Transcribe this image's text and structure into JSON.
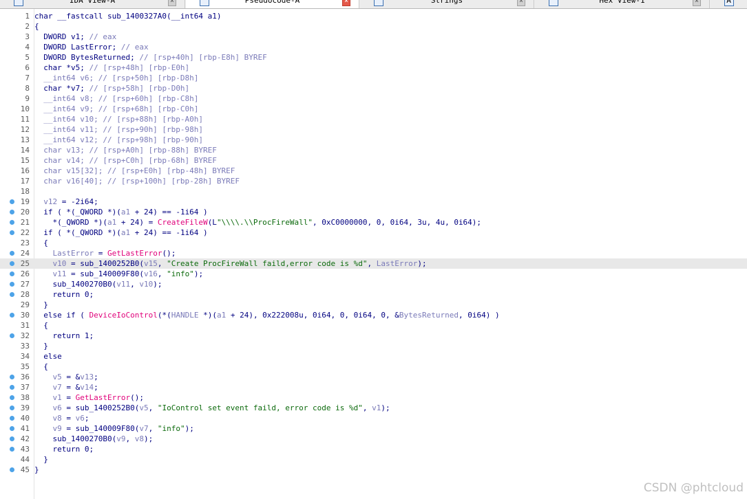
{
  "tabs": [
    {
      "label": "IDA View-A",
      "icon": "ida-view-icon",
      "active": false,
      "close_red": false
    },
    {
      "label": "Pseudocode-A",
      "icon": "pseudocode-icon",
      "active": true,
      "close_red": true
    },
    {
      "label": "Strings",
      "icon": "strings-icon",
      "active": false,
      "close_red": false
    },
    {
      "label": "Hex View-1",
      "icon": "hex-view-icon",
      "active": false,
      "close_red": false
    },
    {
      "label": "A",
      "icon": "structures-icon",
      "active": false,
      "close_red": false
    }
  ],
  "highlighted_line": 25,
  "lines": [
    {
      "n": "1",
      "dot": false,
      "tokens": [
        [
          "def",
          "char __fastcall sub_1400327A0(__int64 a1)"
        ]
      ]
    },
    {
      "n": "2",
      "dot": false,
      "tokens": [
        [
          "def",
          "{"
        ]
      ]
    },
    {
      "n": "3",
      "dot": false,
      "tokens": [
        [
          "def",
          "  DWORD v1; "
        ],
        [
          "cmt",
          "// eax"
        ]
      ]
    },
    {
      "n": "4",
      "dot": false,
      "tokens": [
        [
          "def",
          "  DWORD LastError; "
        ],
        [
          "cmt",
          "// eax"
        ]
      ]
    },
    {
      "n": "5",
      "dot": false,
      "tokens": [
        [
          "def",
          "  DWORD BytesReturned; "
        ],
        [
          "cmt",
          "// [rsp+40h] [rbp-E8h] BYREF"
        ]
      ]
    },
    {
      "n": "6",
      "dot": false,
      "tokens": [
        [
          "def",
          "  char *v5; "
        ],
        [
          "cmt",
          "// [rsp+48h] [rbp-E0h]"
        ]
      ]
    },
    {
      "n": "7",
      "dot": false,
      "tokens": [
        [
          "cmt",
          "  __int64 v6; // [rsp+50h] [rbp-D8h]"
        ]
      ]
    },
    {
      "n": "8",
      "dot": false,
      "tokens": [
        [
          "def",
          "  char *v7; "
        ],
        [
          "cmt",
          "// [rsp+58h] [rbp-D0h]"
        ]
      ]
    },
    {
      "n": "9",
      "dot": false,
      "tokens": [
        [
          "cmt",
          "  __int64 v8; // [rsp+60h] [rbp-C8h]"
        ]
      ]
    },
    {
      "n": "10",
      "dot": false,
      "tokens": [
        [
          "cmt",
          "  __int64 v9; // [rsp+68h] [rbp-C0h]"
        ]
      ]
    },
    {
      "n": "11",
      "dot": false,
      "tokens": [
        [
          "cmt",
          "  __int64 v10; // [rsp+88h] [rbp-A0h]"
        ]
      ]
    },
    {
      "n": "12",
      "dot": false,
      "tokens": [
        [
          "cmt",
          "  __int64 v11; // [rsp+90h] [rbp-98h]"
        ]
      ]
    },
    {
      "n": "13",
      "dot": false,
      "tokens": [
        [
          "cmt",
          "  __int64 v12; // [rsp+98h] [rbp-90h]"
        ]
      ]
    },
    {
      "n": "14",
      "dot": false,
      "tokens": [
        [
          "cmt",
          "  char v13; // [rsp+A0h] [rbp-88h] BYREF"
        ]
      ]
    },
    {
      "n": "15",
      "dot": false,
      "tokens": [
        [
          "cmt",
          "  char v14; // [rsp+C0h] [rbp-68h] BYREF"
        ]
      ]
    },
    {
      "n": "16",
      "dot": false,
      "tokens": [
        [
          "cmt",
          "  char v15[32]; // [rsp+E0h] [rbp-48h] BYREF"
        ]
      ]
    },
    {
      "n": "17",
      "dot": false,
      "tokens": [
        [
          "cmt",
          "  char v16[40]; // [rsp+100h] [rbp-28h] BYREF"
        ]
      ]
    },
    {
      "n": "18",
      "dot": false,
      "tokens": [
        [
          "def",
          ""
        ]
      ]
    },
    {
      "n": "19",
      "dot": true,
      "tokens": [
        [
          "var",
          "  v12"
        ],
        [
          "def",
          " = -2i64;"
        ]
      ]
    },
    {
      "n": "20",
      "dot": true,
      "tokens": [
        [
          "def",
          "  if ( *(_QWORD *)("
        ],
        [
          "var",
          "a1"
        ],
        [
          "def",
          " + 24) == -1i64 )"
        ]
      ]
    },
    {
      "n": "21",
      "dot": true,
      "tokens": [
        [
          "def",
          "    *(_QWORD *)("
        ],
        [
          "var",
          "a1"
        ],
        [
          "def",
          " + 24) = "
        ],
        [
          "fn",
          "CreateFileW"
        ],
        [
          "def",
          "(L"
        ],
        [
          "str",
          "\"\\\\\\\\.\\\\ProcFireWall\""
        ],
        [
          "def",
          ", 0xC0000000, 0, 0i64, 3u, 4u, 0i64);"
        ]
      ]
    },
    {
      "n": "22",
      "dot": true,
      "tokens": [
        [
          "def",
          "  if ( *(_QWORD *)("
        ],
        [
          "var",
          "a1"
        ],
        [
          "def",
          " + 24) == -1i64 )"
        ]
      ]
    },
    {
      "n": "23",
      "dot": false,
      "tokens": [
        [
          "def",
          "  {"
        ]
      ]
    },
    {
      "n": "24",
      "dot": true,
      "tokens": [
        [
          "var",
          "    LastError"
        ],
        [
          "def",
          " = "
        ],
        [
          "fn",
          "GetLastError"
        ],
        [
          "def",
          "();"
        ]
      ]
    },
    {
      "n": "25",
      "dot": true,
      "tokens": [
        [
          "var",
          "    v10"
        ],
        [
          "def",
          " = sub_1400252B0("
        ],
        [
          "var",
          "v15"
        ],
        [
          "def",
          ", "
        ],
        [
          "str",
          "\"Create ProcFireWall faild,error code is %d\""
        ],
        [
          "def",
          ", "
        ],
        [
          "var",
          "LastError"
        ],
        [
          "def",
          ");"
        ]
      ]
    },
    {
      "n": "26",
      "dot": true,
      "tokens": [
        [
          "var",
          "    v11"
        ],
        [
          "def",
          " = sub_140009F80("
        ],
        [
          "var",
          "v16"
        ],
        [
          "def",
          ", "
        ],
        [
          "str",
          "\"info\""
        ],
        [
          "def",
          ");"
        ]
      ]
    },
    {
      "n": "27",
      "dot": true,
      "tokens": [
        [
          "def",
          "    sub_1400270B0("
        ],
        [
          "var",
          "v11"
        ],
        [
          "def",
          ", "
        ],
        [
          "var",
          "v10"
        ],
        [
          "def",
          ");"
        ]
      ]
    },
    {
      "n": "28",
      "dot": true,
      "tokens": [
        [
          "def",
          "    return 0;"
        ]
      ]
    },
    {
      "n": "29",
      "dot": false,
      "tokens": [
        [
          "def",
          "  }"
        ]
      ]
    },
    {
      "n": "30",
      "dot": true,
      "tokens": [
        [
          "def",
          "  else if ( "
        ],
        [
          "fn",
          "DeviceIoControl"
        ],
        [
          "def",
          "(*("
        ],
        [
          "cmt",
          "HANDLE"
        ],
        [
          "def",
          " *)("
        ],
        [
          "var",
          "a1"
        ],
        [
          "def",
          " + 24), 0x222008u, 0i64, 0, 0i64, 0, &"
        ],
        [
          "var",
          "BytesReturned"
        ],
        [
          "def",
          ", 0i64) )"
        ]
      ]
    },
    {
      "n": "31",
      "dot": false,
      "tokens": [
        [
          "def",
          "  {"
        ]
      ]
    },
    {
      "n": "32",
      "dot": true,
      "tokens": [
        [
          "def",
          "    return 1;"
        ]
      ]
    },
    {
      "n": "33",
      "dot": false,
      "tokens": [
        [
          "def",
          "  }"
        ]
      ]
    },
    {
      "n": "34",
      "dot": false,
      "tokens": [
        [
          "def",
          "  else"
        ]
      ]
    },
    {
      "n": "35",
      "dot": false,
      "tokens": [
        [
          "def",
          "  {"
        ]
      ]
    },
    {
      "n": "36",
      "dot": true,
      "tokens": [
        [
          "var",
          "    v5"
        ],
        [
          "def",
          " = &"
        ],
        [
          "var",
          "v13"
        ],
        [
          "def",
          ";"
        ]
      ]
    },
    {
      "n": "37",
      "dot": true,
      "tokens": [
        [
          "var",
          "    v7"
        ],
        [
          "def",
          " = &"
        ],
        [
          "var",
          "v14"
        ],
        [
          "def",
          ";"
        ]
      ]
    },
    {
      "n": "38",
      "dot": true,
      "tokens": [
        [
          "var",
          "    v1"
        ],
        [
          "def",
          " = "
        ],
        [
          "fn",
          "GetLastError"
        ],
        [
          "def",
          "();"
        ]
      ]
    },
    {
      "n": "39",
      "dot": true,
      "tokens": [
        [
          "var",
          "    v6"
        ],
        [
          "def",
          " = sub_1400252B0("
        ],
        [
          "var",
          "v5"
        ],
        [
          "def",
          ", "
        ],
        [
          "str",
          "\"IoControl set event faild, error code is %d\""
        ],
        [
          "def",
          ", "
        ],
        [
          "var",
          "v1"
        ],
        [
          "def",
          ");"
        ]
      ]
    },
    {
      "n": "40",
      "dot": true,
      "tokens": [
        [
          "var",
          "    v8"
        ],
        [
          "def",
          " = "
        ],
        [
          "var",
          "v6"
        ],
        [
          "def",
          ";"
        ]
      ]
    },
    {
      "n": "41",
      "dot": true,
      "tokens": [
        [
          "var",
          "    v9"
        ],
        [
          "def",
          " = sub_140009F80("
        ],
        [
          "var",
          "v7"
        ],
        [
          "def",
          ", "
        ],
        [
          "str",
          "\"info\""
        ],
        [
          "def",
          ");"
        ]
      ]
    },
    {
      "n": "42",
      "dot": true,
      "tokens": [
        [
          "def",
          "    sub_1400270B0("
        ],
        [
          "var",
          "v9"
        ],
        [
          "def",
          ", "
        ],
        [
          "var",
          "v8"
        ],
        [
          "def",
          ");"
        ]
      ]
    },
    {
      "n": "43",
      "dot": true,
      "tokens": [
        [
          "def",
          "    return 0;"
        ]
      ]
    },
    {
      "n": "44",
      "dot": false,
      "tokens": [
        [
          "def",
          "  }"
        ]
      ]
    },
    {
      "n": "45",
      "dot": true,
      "tokens": [
        [
          "def",
          "}"
        ]
      ]
    }
  ],
  "watermark": "CSDN @phtcloud",
  "colors": {
    "keyword": "#000080",
    "comment": "#7a7ab8",
    "function": "#e0007a",
    "string": "#0c6a0c",
    "breakpoint_dot": "#4da3e8",
    "highlight": "#e8e8e8"
  }
}
